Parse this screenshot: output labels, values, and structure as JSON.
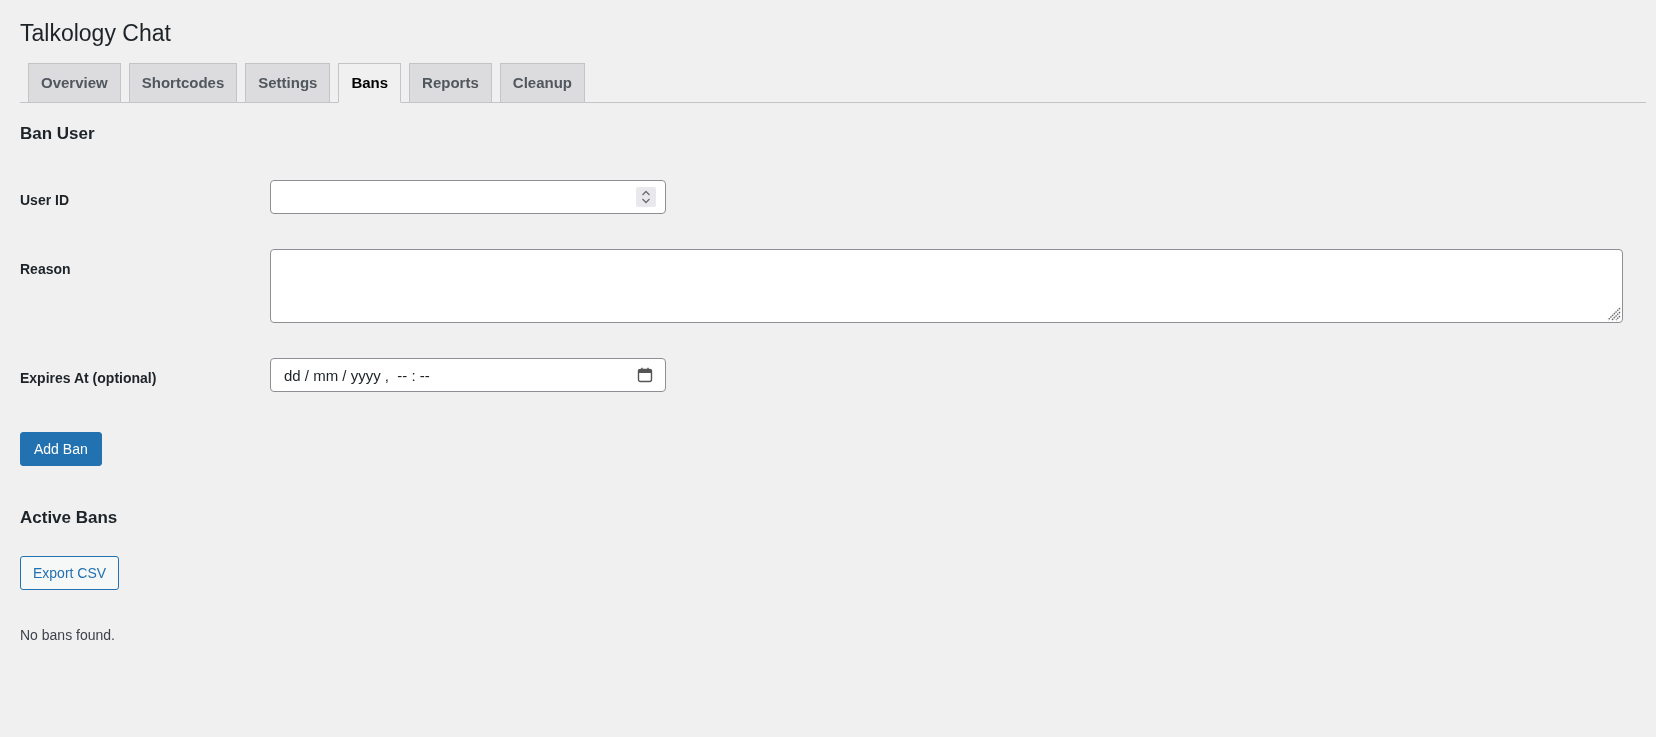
{
  "page_title": "Talkology Chat",
  "tabs": [
    {
      "label": "Overview",
      "selected": false
    },
    {
      "label": "Shortcodes",
      "selected": false
    },
    {
      "label": "Settings",
      "selected": false
    },
    {
      "label": "Bans",
      "selected": true
    },
    {
      "label": "Reports",
      "selected": false
    },
    {
      "label": "Cleanup",
      "selected": false
    }
  ],
  "ban_form": {
    "heading": "Ban User",
    "fields": [
      {
        "kind": "number",
        "label": "User ID"
      },
      {
        "kind": "textarea",
        "label": "Reason"
      },
      {
        "kind": "datetime",
        "label": "Expires At (optional)",
        "placeholder": "dd / mm / yyyy ,  -- : --"
      }
    ],
    "submit_button": "Add Ban"
  },
  "active_bans": {
    "heading": "Active Bans",
    "export_button": "Export CSV",
    "empty_message": "No bans found."
  }
}
